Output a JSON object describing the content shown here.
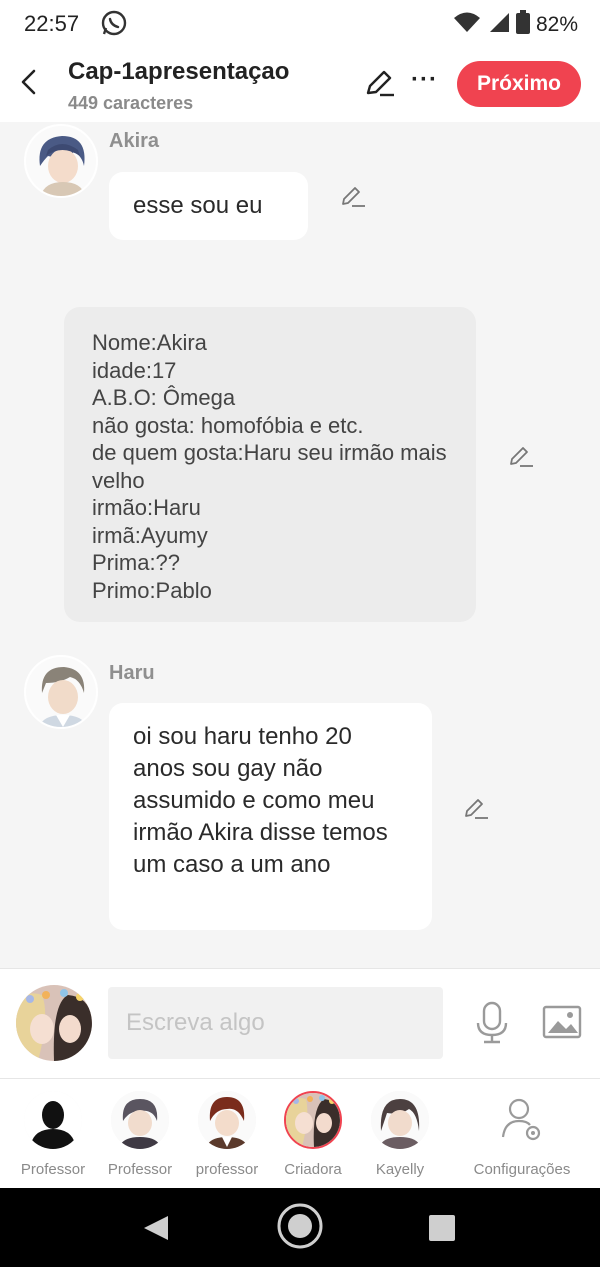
{
  "status_bar": {
    "time": "22:57",
    "battery": "82%"
  },
  "header": {
    "title": "Cap-1apresentaçao",
    "subtitle": "449 caracteres",
    "next_label": "Próximo"
  },
  "messages": [
    {
      "type": "character",
      "name": "Akira",
      "text": "esse sou eu"
    },
    {
      "type": "narration",
      "text": "Nome:Akira\nidade:17\nA.B.O: Ômega\nnão gosta: homofóbia e etc.\nde quem gosta:Haru seu irmão mais velho\nirmão:Haru\nirmã:Ayumy\nPrima:??\nPrimo:Pablo"
    },
    {
      "type": "character",
      "name": "Haru",
      "text": "oi sou haru tenho 20 anos sou gay não assumido e como meu irmão Akira disse temos um caso a um ano"
    }
  ],
  "composer": {
    "placeholder": "Escreva algo"
  },
  "characters": [
    {
      "label": "Professor"
    },
    {
      "label": "Professor"
    },
    {
      "label": "professor"
    },
    {
      "label": "Criadora"
    },
    {
      "label": "Kayelly"
    },
    {
      "label": "Configurações"
    }
  ],
  "colors": {
    "accent": "#f04350",
    "background": "#f5f5f5",
    "bubble": "#ffffff",
    "narration": "#ececec"
  }
}
